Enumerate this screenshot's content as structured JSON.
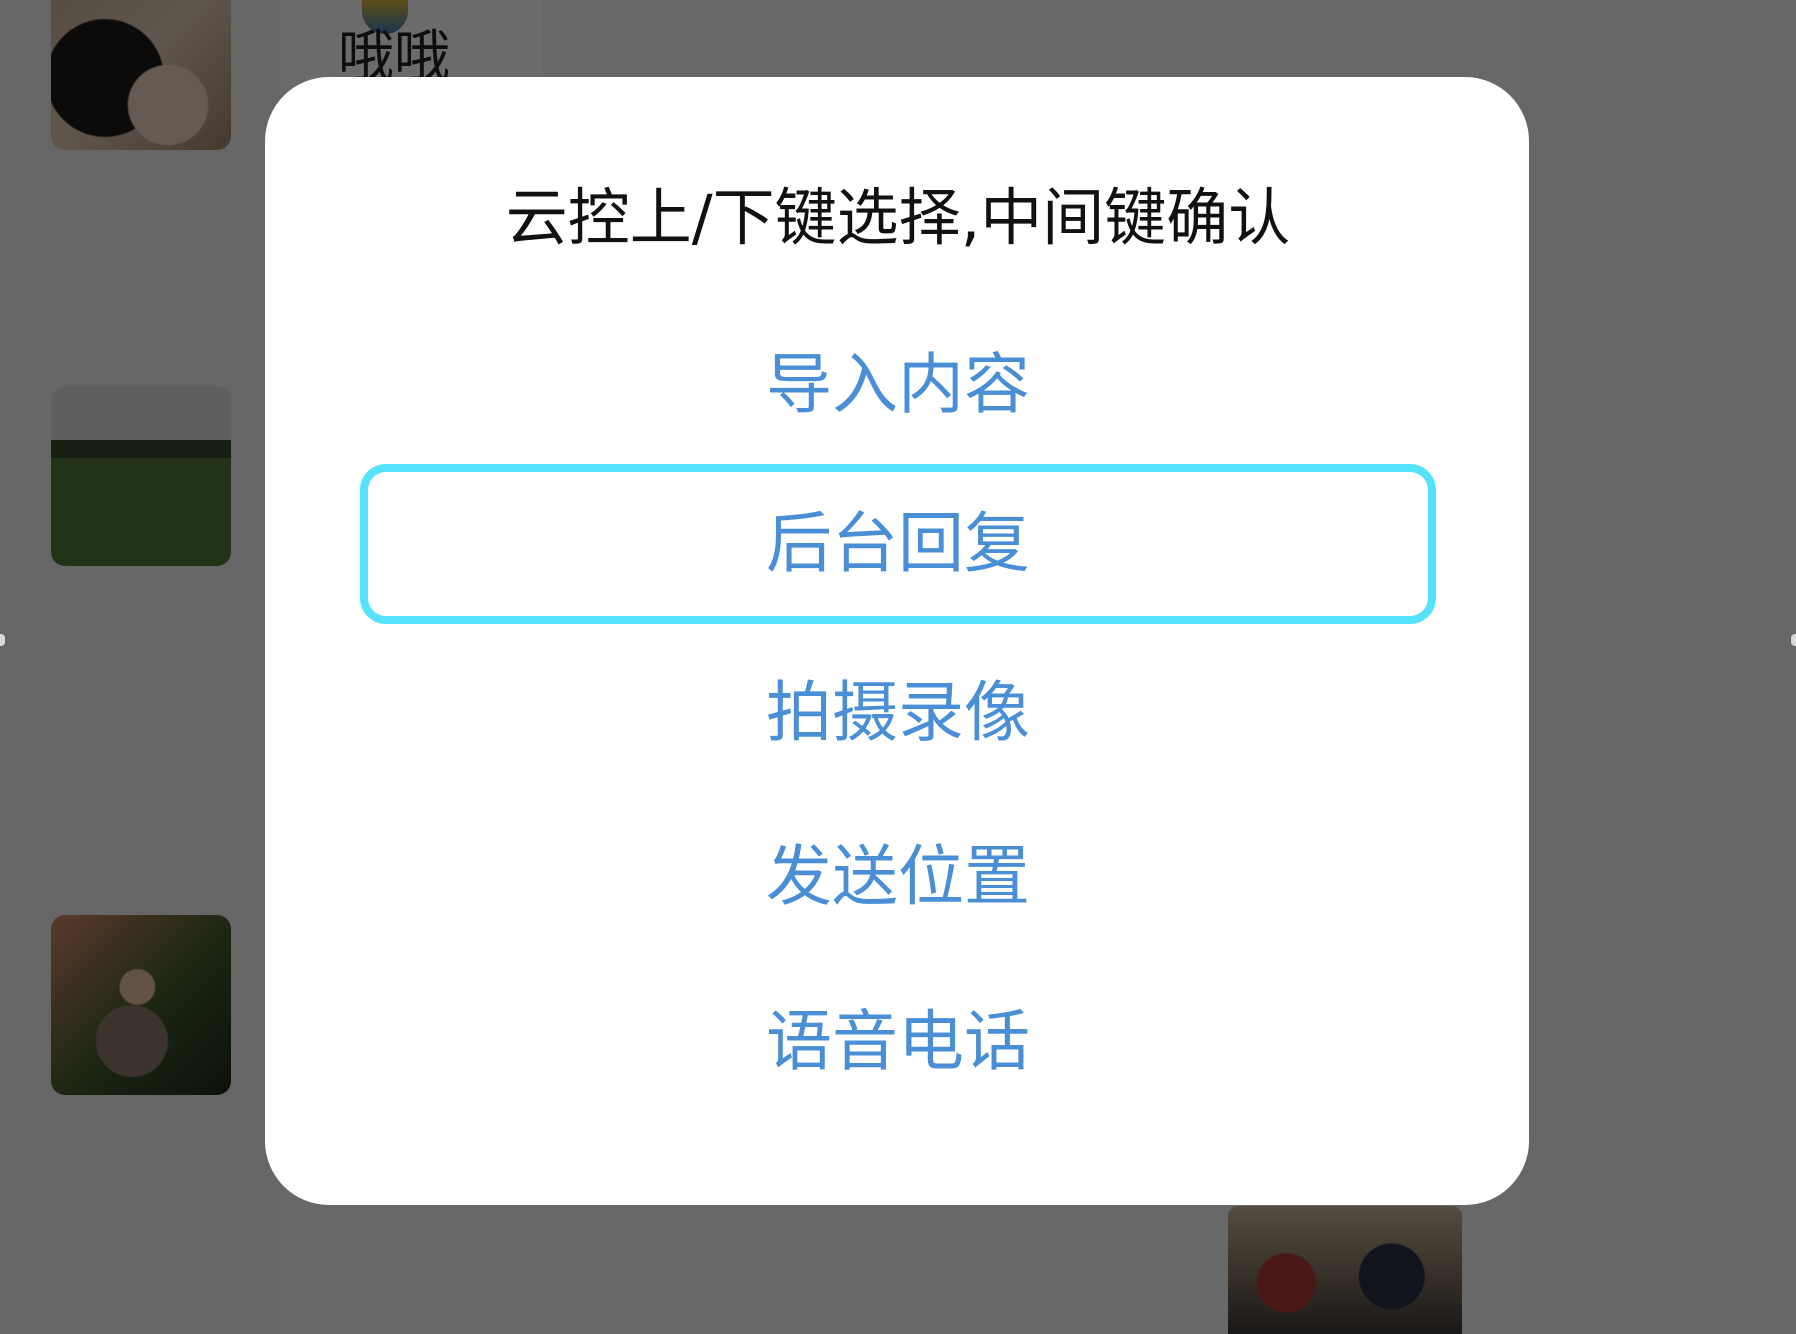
{
  "background": {
    "contact_name": "哦哦"
  },
  "dialog": {
    "title": "云控上/下键选择,中间键确认",
    "selected_index": 1,
    "items": [
      {
        "label": "导入内容"
      },
      {
        "label": "后台回复"
      },
      {
        "label": "拍摄录像"
      },
      {
        "label": "发送位置"
      },
      {
        "label": "语音电话"
      }
    ]
  },
  "colors": {
    "item_text": "#4a8fd6",
    "focus_border": "#55e2fb",
    "title_text": "#111111"
  }
}
